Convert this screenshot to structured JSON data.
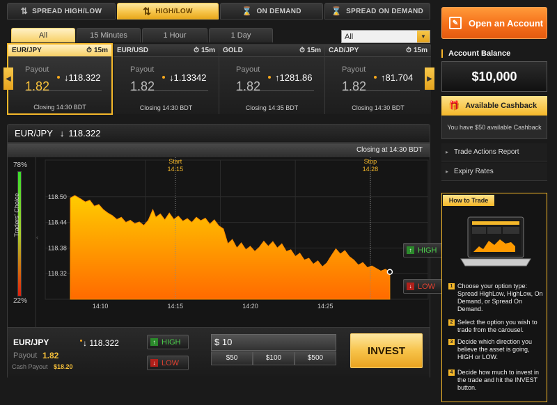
{
  "top_tabs": [
    {
      "label": "SPREAD HIGH/LOW",
      "active": false
    },
    {
      "label": "HIGH/LOW",
      "active": true
    },
    {
      "label": "ON DEMAND",
      "active": false
    },
    {
      "label": "SPREAD ON DEMAND",
      "active": false
    }
  ],
  "filter_tabs": [
    "All",
    "15 Minutes",
    "1 Hour",
    "1 Day"
  ],
  "asset_select": {
    "value": "All"
  },
  "carousel": [
    {
      "symbol": "EUR/JPY",
      "timer": "15m",
      "payout_label": "Payout",
      "payout": "1.82",
      "direction": "↓",
      "price": "118.322",
      "closing": "Closing 14:30 BDT"
    },
    {
      "symbol": "EUR/USD",
      "timer": "15m",
      "payout_label": "Payout",
      "payout": "1.82",
      "direction": "↓",
      "price": "1.13342",
      "closing": "Closing 14:30 BDT"
    },
    {
      "symbol": "GOLD",
      "timer": "15m",
      "payout_label": "Payout",
      "payout": "1.82",
      "direction": "↑",
      "price": "1281.86",
      "closing": "Closing 14:35 BDT"
    },
    {
      "symbol": "CAD/JPY",
      "timer": "15m",
      "payout_label": "Payout",
      "payout": "1.82",
      "direction": "↑",
      "price": "81.704",
      "closing": "Closing 14:30 BDT"
    }
  ],
  "chart_panel": {
    "symbol": "EUR/JPY",
    "direction": "↓",
    "price": "118.322",
    "closing_label": "Closing at 14:30 BDT",
    "traders_label": "Traders' Choice",
    "traders_high_pct": "78%",
    "traders_low_pct": "22%",
    "traders_high_fraction": 0.78,
    "start_label": "Start",
    "start_time": "14:15",
    "stop_label": "Stop",
    "stop_time": "14:28",
    "high_btn": "HIGH",
    "low_btn": "LOW"
  },
  "chart_data": {
    "type": "area",
    "x_ticks": [
      "14:10",
      "14:15",
      "14:20",
      "14:25"
    ],
    "y_ticks": [
      "118.50",
      "118.44",
      "118.38",
      "118.32"
    ],
    "x_range": [
      0,
      22
    ],
    "y_range": [
      118.26,
      118.56
    ],
    "start_x": 7,
    "stop_x": 20,
    "tick_x": [
      5,
      10,
      15,
      20
    ],
    "tick_y": [
      118.5,
      118.44,
      118.38,
      118.32
    ],
    "x_ticks_pos": [
      2,
      7,
      12,
      17
    ],
    "points": [
      [
        0,
        118.497
      ],
      [
        0.3,
        118.503
      ],
      [
        0.7,
        118.495
      ],
      [
        1.0,
        118.488
      ],
      [
        1.3,
        118.492
      ],
      [
        1.6,
        118.478
      ],
      [
        1.9,
        118.482
      ],
      [
        2.2,
        118.47
      ],
      [
        2.5,
        118.462
      ],
      [
        2.8,
        118.456
      ],
      [
        3.1,
        118.447
      ],
      [
        3.4,
        118.452
      ],
      [
        3.7,
        118.44
      ],
      [
        4.0,
        118.445
      ],
      [
        4.3,
        118.437
      ],
      [
        4.6,
        118.441
      ],
      [
        4.9,
        118.433
      ],
      [
        5.2,
        118.445
      ],
      [
        5.5,
        118.47
      ],
      [
        5.7,
        118.452
      ],
      [
        6.0,
        118.46
      ],
      [
        6.3,
        118.446
      ],
      [
        6.6,
        118.462
      ],
      [
        6.9,
        118.447
      ],
      [
        7.2,
        118.455
      ],
      [
        7.5,
        118.443
      ],
      [
        7.8,
        118.449
      ],
      [
        8.1,
        118.44
      ],
      [
        8.4,
        118.452
      ],
      [
        8.7,
        118.444
      ],
      [
        9.0,
        118.45
      ],
      [
        9.3,
        118.436
      ],
      [
        9.6,
        118.446
      ],
      [
        9.9,
        118.432
      ],
      [
        10.2,
        118.425
      ],
      [
        10.5,
        118.39
      ],
      [
        10.8,
        118.4
      ],
      [
        11.1,
        118.38
      ],
      [
        11.4,
        118.392
      ],
      [
        11.7,
        118.376
      ],
      [
        12.0,
        118.384
      ],
      [
        12.3,
        118.372
      ],
      [
        12.6,
        118.382
      ],
      [
        12.9,
        118.396
      ],
      [
        13.2,
        118.384
      ],
      [
        13.5,
        118.395
      ],
      [
        13.8,
        118.38
      ],
      [
        14.1,
        118.39
      ],
      [
        14.4,
        118.372
      ],
      [
        14.7,
        118.376
      ],
      [
        15.0,
        118.36
      ],
      [
        15.3,
        118.368
      ],
      [
        15.6,
        118.352
      ],
      [
        15.9,
        118.356
      ],
      [
        16.2,
        118.342
      ],
      [
        16.5,
        118.35
      ],
      [
        16.8,
        118.336
      ],
      [
        17.1,
        118.345
      ],
      [
        17.4,
        118.362
      ],
      [
        17.7,
        118.378
      ],
      [
        18.0,
        118.366
      ],
      [
        18.3,
        118.374
      ],
      [
        18.6,
        118.36
      ],
      [
        18.9,
        118.352
      ],
      [
        19.2,
        118.34
      ],
      [
        19.5,
        118.346
      ],
      [
        19.8,
        118.334
      ],
      [
        20.1,
        118.338
      ],
      [
        20.4,
        118.332
      ],
      [
        20.7,
        118.326
      ],
      [
        21.0,
        118.33
      ],
      [
        21.3,
        118.324
      ]
    ],
    "colors": {
      "top": "#ffcc00",
      "bottom": "#ff6a00"
    }
  },
  "trade": {
    "symbol": "EUR/JPY",
    "direction": "↓",
    "price": "118.322",
    "payout_label": "Payout",
    "payout": "1.82",
    "cash_label": "Cash Payout",
    "cash_value": "$18.20",
    "high_label": "HIGH",
    "low_label": "LOW",
    "amount": "$ 10",
    "presets": [
      "$50",
      "$100",
      "$500"
    ],
    "invest": "INVEST"
  },
  "right_panel": {
    "open_account": "Open an Account",
    "balance_label": "Account Balance",
    "balance": "$10,000",
    "cashback_title": "Available Cashback",
    "cashback_text": "You have $50 available Cashback",
    "links": [
      "Trade Actions Report",
      "Expiry Rates"
    ],
    "howto_tab": "How to Trade",
    "steps": [
      "Choose your option type: Spread HighLow, HighLow, On Demand, or Spread On Demand.",
      "Select the option you wish to trade from the carousel.",
      "Decide which direction you believe the asset is going, HIGH or LOW.",
      "Decide how much to invest in the trade and hit the INVEST button."
    ]
  },
  "colors": {
    "accent": "#f5b82a",
    "orange": "#f5701a",
    "high": "#6fd13a",
    "low": "#e03020"
  }
}
